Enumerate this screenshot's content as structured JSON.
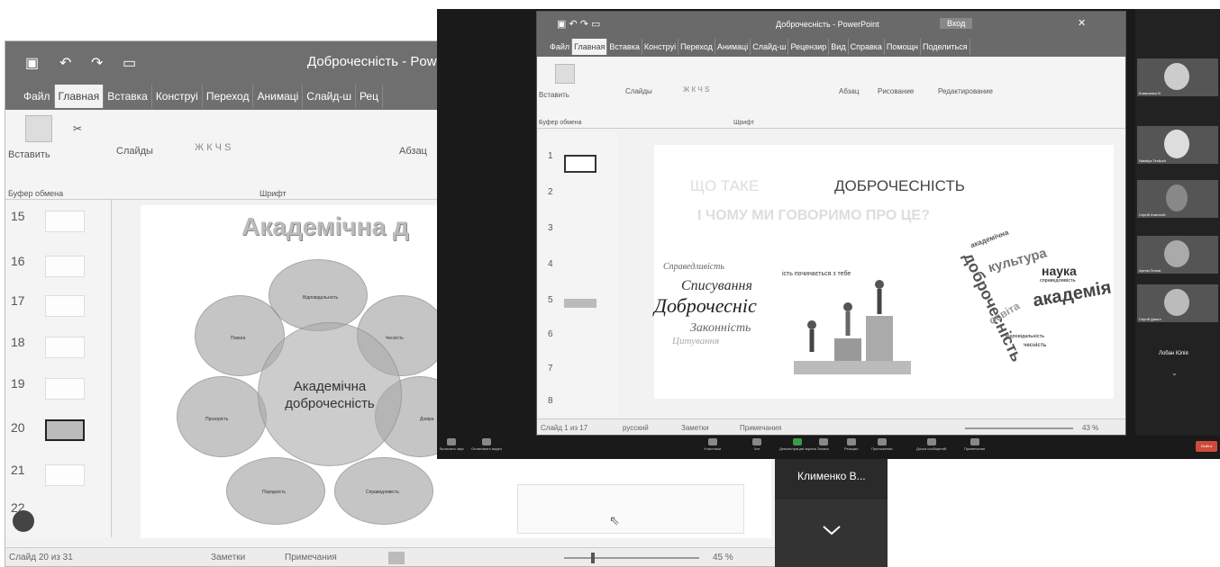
{
  "back_window": {
    "doc_title": "Доброчесність - Pow",
    "tabs": [
      "Файл",
      "Главная",
      "Вставка",
      "Конструі",
      "Переход",
      "Анимаці",
      "Слайд-ш",
      "Рец"
    ],
    "ribbon": {
      "paste": "Вставить",
      "slides": "Слайды",
      "font_group": "Шрифт",
      "paragraph": "Абзац",
      "clipboard": "Буфер обмена",
      "bold_italic": "Ж К Ч S"
    },
    "thumb_numbers": [
      "15",
      "16",
      "17",
      "18",
      "19",
      "20",
      "21",
      "22"
    ],
    "slide": {
      "title": "Академічна д",
      "center": "Академічна доброчесність",
      "labels": [
        "Відповідальність",
        "Повага",
        "Чесність",
        "Прозорість",
        "Довіра",
        "Порядність",
        "Справедливість"
      ]
    },
    "status": {
      "slide_count": "Слайд 20 из 31",
      "notes": "Заметки",
      "comments": "Примечания",
      "zoom": "45 %"
    }
  },
  "zoom": {
    "inner_ppt": {
      "doc_title": "Доброчесність - PowerPoint",
      "sign_in": "Вход",
      "tabs": [
        "Файл",
        "Главная",
        "Вставка",
        "Конструі",
        "Переход",
        "Анимаці",
        "Слайд-ш",
        "Рецензир",
        "Вид",
        "Справка",
        "Помощн",
        "Поделиться"
      ],
      "ribbon": {
        "paste": "Вставить",
        "slides": "Слайды",
        "font_group": "Шрифт",
        "clipboard": "Буфер обмена",
        "paragraph": "Абзац",
        "drawing": "Рисование",
        "editing": "Редактирование",
        "bold_italic": "Ж К Ч S"
      },
      "thumb_numbers": [
        "1",
        "2",
        "3",
        "4",
        "5",
        "6",
        "7",
        "8"
      ],
      "slide": {
        "title_line1_faded": "ЩО ТАКЕ",
        "title_line1": "ДОБРОЧЕСНІСТЬ",
        "title_line2": "І ЧОМУ МИ ГОВОРИМО ПРО ЦЕ?",
        "quote": "ість починається з тебе",
        "script_words": [
          "Справедливість",
          "Списування",
          "Доброчесніс",
          "Законність",
          "Цитування"
        ],
        "cloud_words": [
          "академічна",
          "культура",
          "наука",
          "академія",
          "доброчесність",
          "освіта",
          "справедливість",
          "відповідальність",
          "чесність"
        ]
      },
      "status": {
        "slide_count": "Слайд 1 из 17",
        "language": "русский",
        "notes": "Заметки",
        "comments": "Примечания",
        "zoom": "43 %"
      }
    },
    "participants": [
      {
        "name": "Климченко В"
      },
      {
        "name": "Nataliya Tesliuch"
      },
      {
        "name": "Сергій Анатолій"
      },
      {
        "name": "Артем Попов"
      },
      {
        "name": "Сергій Данил"
      }
    ],
    "highlighted_name": "Лобан Юлія",
    "toolbar": [
      "Включить звук",
      "Остановить видео",
      "Участники",
      "Чат",
      "Демонстрация экрана",
      "Запись",
      "Реакции",
      "Приложения",
      "Доска сообщений",
      "Примечания"
    ],
    "end_label": "Выйти"
  },
  "strip": {
    "name": "Клименко В...",
    "chevron": "chevron-down-icon"
  },
  "colors": {
    "zoom_dark": "#1a1a1a",
    "ppt_title_gray": "#6f6f6f",
    "end_button": "#d04a3a"
  }
}
